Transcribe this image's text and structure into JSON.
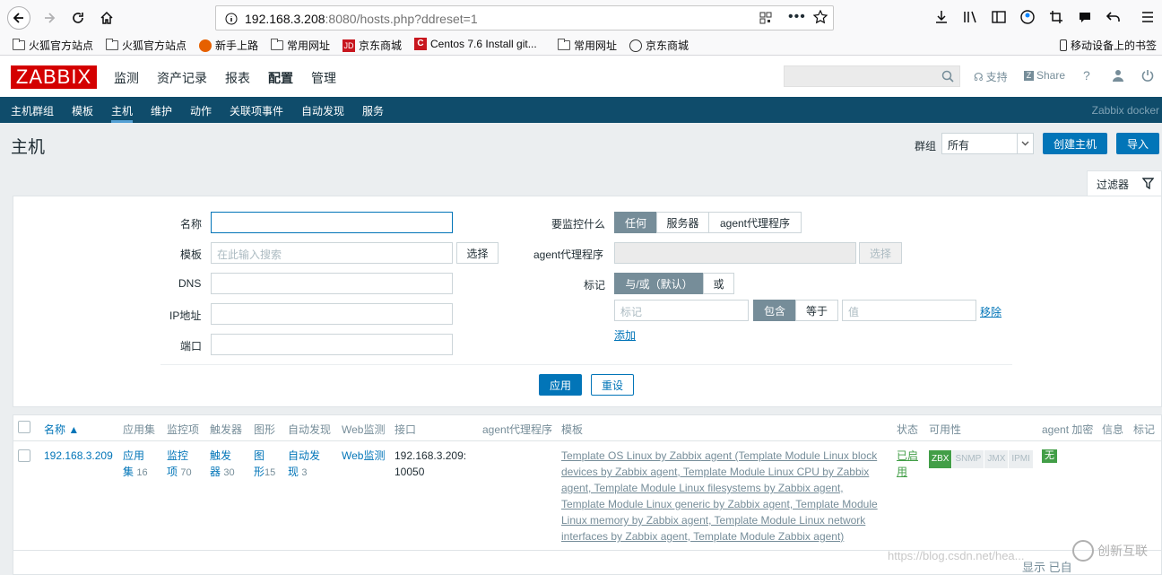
{
  "browser": {
    "url_host": "192.168.3.208",
    "url_rest": ":8080/hosts.php?ddreset=1",
    "bookmarks": [
      "火狐官方站点",
      "火狐官方站点",
      "新手上路",
      "常用网址",
      "京东商城",
      "Centos 7.6 Install git...",
      "常用网址",
      "京东商城"
    ],
    "mobile_bookmarks": "移动设备上的书签"
  },
  "header": {
    "logo": "ZABBIX",
    "menu": [
      "监测",
      "资产记录",
      "报表",
      "配置",
      "管理"
    ],
    "support": "支持",
    "share": "Share",
    "help": "?"
  },
  "subnav": {
    "items": [
      "主机群组",
      "模板",
      "主机",
      "维护",
      "动作",
      "关联项事件",
      "自动发现",
      "服务"
    ],
    "right": "Zabbix docker"
  },
  "page": {
    "title": "主机",
    "group_label": "群组",
    "group_value": "所有",
    "create_button": "创建主机",
    "import_button": "导入"
  },
  "filter": {
    "tab": "过滤器",
    "name_label": "名称",
    "template_label": "模板",
    "template_placeholder": "在此输入搜索",
    "select_button": "选择",
    "dns_label": "DNS",
    "ip_label": "IP地址",
    "port_label": "端口",
    "monitor_label": "要监控什么",
    "monitor_options": [
      "任何",
      "服务器",
      "agent代理程序"
    ],
    "proxy_label": "agent代理程序",
    "proxy_select": "选择",
    "tags_label": "标记",
    "tag_ops": [
      "与/或（默认）",
      "或"
    ],
    "tag_placeholder": "标记",
    "tag_modes": [
      "包含",
      "等于"
    ],
    "value_placeholder": "值",
    "remove": "移除",
    "add": "添加",
    "apply": "应用",
    "reset": "重设"
  },
  "table": {
    "columns": [
      "名称 ▲",
      "应用集",
      "监控项",
      "触发器",
      "图形",
      "自动发现",
      "Web监测",
      "接口",
      "agent代理程序",
      "模板",
      "状态",
      "可用性",
      "agent 加密",
      "信息",
      "标记"
    ],
    "row": {
      "name": "192.168.3.209",
      "apps": [
        "应用",
        "集"
      ],
      "apps_count": "16",
      "items": [
        "监控",
        "项"
      ],
      "items_count": "70",
      "triggers": [
        "触发",
        "器"
      ],
      "triggers_count": "30",
      "graphs": [
        "图",
        "形"
      ],
      "graphs_count": "15",
      "discovery": [
        "自动发",
        "现"
      ],
      "discovery_count": "3",
      "web": "Web监测",
      "interface": [
        "192.168.3.209:",
        "10050"
      ],
      "templates": [
        "Template OS Linux by Zabbix agent (Template Module Linux block",
        "devices by Zabbix agent, Template Module Linux CPU by Zabbix",
        "agent, Template Module Linux filesystems by Zabbix agent,",
        "Template Module Linux generic by Zabbix agent, Template Module",
        "Linux memory by Zabbix agent, Template Module Linux network",
        "interfaces by Zabbix agent, Template Module Zabbix agent)"
      ],
      "status": [
        "已启",
        "用"
      ],
      "availability": [
        "ZBX",
        "SNMP",
        "JMX",
        "IPMI"
      ],
      "encryption": "无"
    },
    "footer": "显示 已自"
  },
  "watermark": "https://blog.csdn.net/hea...",
  "brand_watermark": "创新互联",
  "colors": {
    "brand": "#d40000",
    "nav": "#0f4c6b",
    "accent": "#0275b8",
    "available": "#429e47"
  }
}
